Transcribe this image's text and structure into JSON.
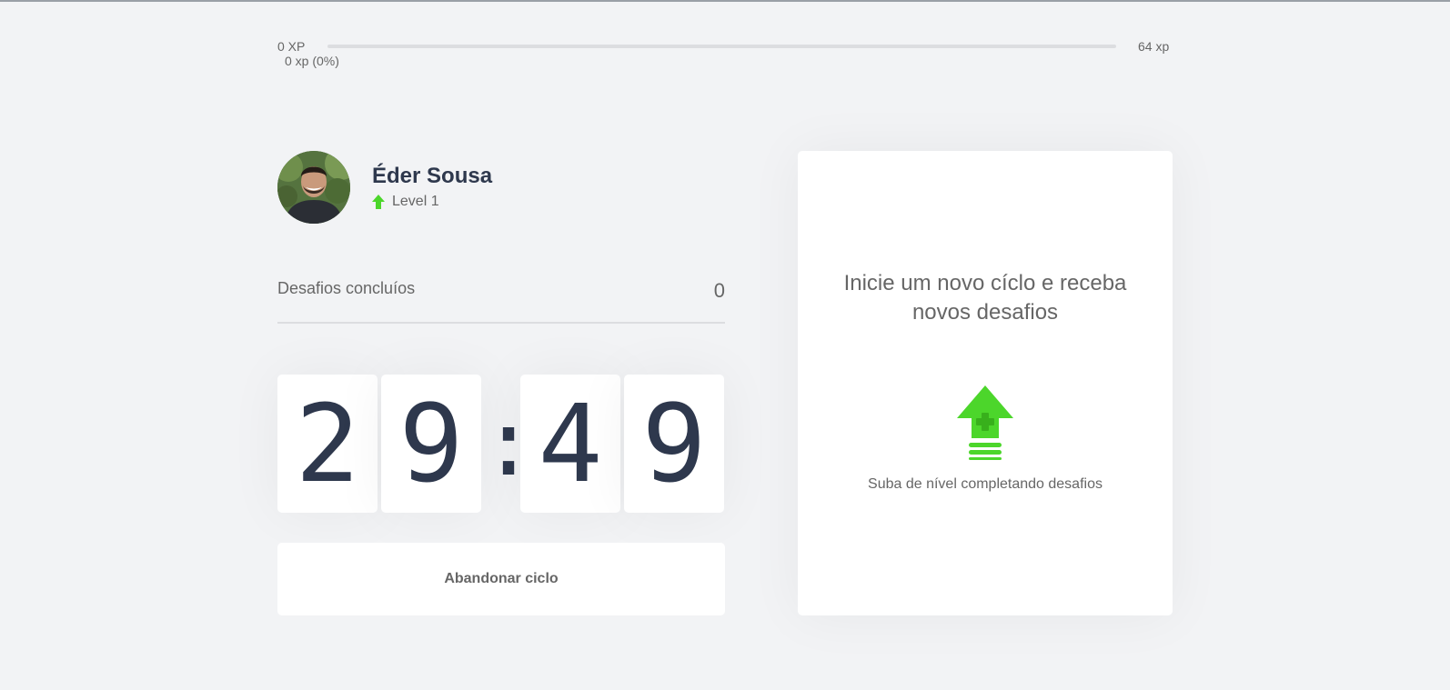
{
  "xp_bar": {
    "min_label": "0 XP",
    "max_label": "64 xp",
    "current_label": "0 xp (0%)",
    "progress_percent": 0
  },
  "profile": {
    "name": "Éder Sousa",
    "level_label": "Level 1"
  },
  "completed_challenges": {
    "label": "Desafios concluíos",
    "value": "0"
  },
  "countdown": {
    "minute_tens": "2",
    "minute_ones": "9",
    "separator": ":",
    "second_tens": "4",
    "second_ones": "9"
  },
  "abandon_button": {
    "label": "Abandonar ciclo"
  },
  "challenge_box": {
    "title": "Inicie um novo cíclo e receba novos desafios",
    "hint": "Suba de nível completando desafios"
  },
  "colors": {
    "accent_green": "#4cd62b",
    "title_dark": "#2e384d",
    "text": "#666666",
    "background": "#f2f3f5"
  },
  "icons": {
    "level": "level-up-arrow-icon",
    "challenge": "level-up-icon"
  }
}
